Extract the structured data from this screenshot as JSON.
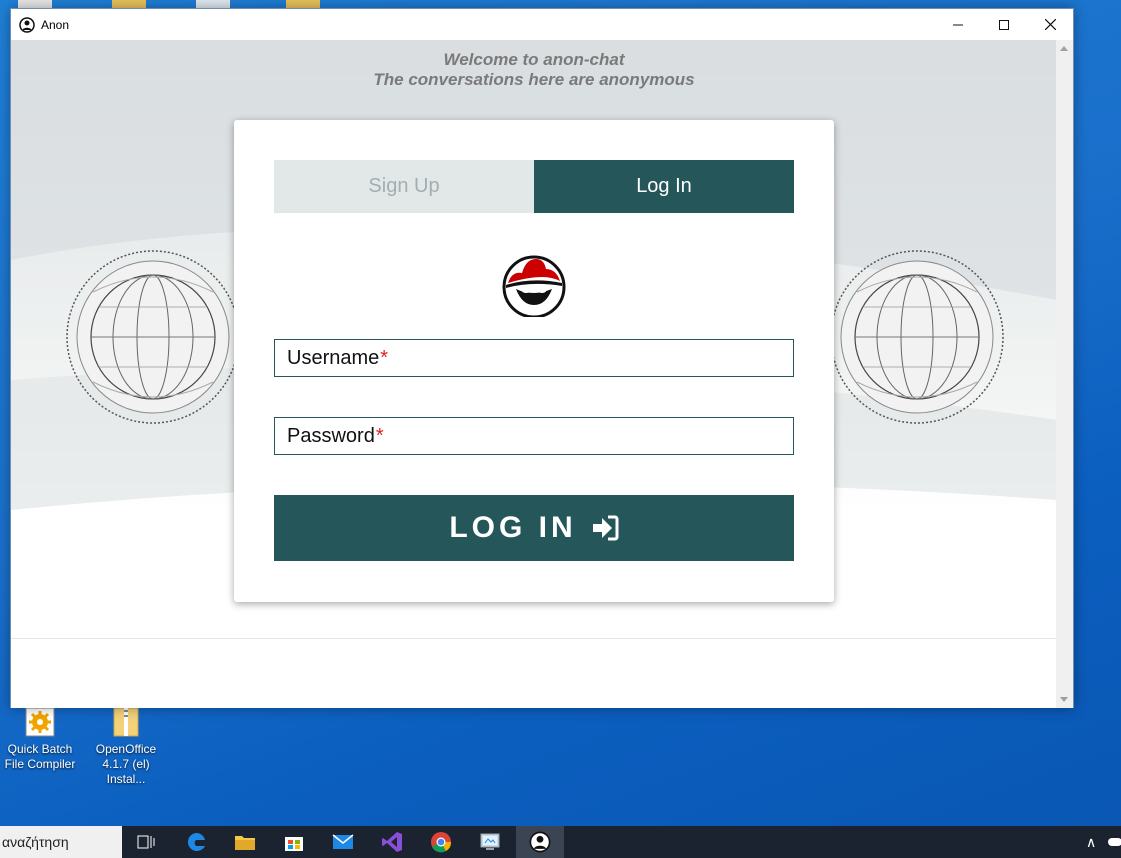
{
  "window": {
    "title": "Anon"
  },
  "welcome": {
    "line1": "Welcome to anon-chat",
    "line2": "The conversations here are anonymous"
  },
  "tabs": [
    {
      "label": "Sign Up",
      "active": false
    },
    {
      "label": "Log In",
      "active": true
    }
  ],
  "form": {
    "username_label": "Username",
    "password_label": "Password",
    "required_mark": "*",
    "submit_label": "LOG IN"
  },
  "desktop_icons": [
    {
      "label": "Quick Batch File Compiler"
    },
    {
      "label": "OpenOffice 4.1.7 (el) Instal..."
    }
  ],
  "taskbar": {
    "search_text": "αναζήτηση",
    "apps": [
      "task-view",
      "edge",
      "file-explorer",
      "store",
      "mail",
      "visual-studio",
      "chrome",
      "control-panel",
      "anon"
    ]
  },
  "colors": {
    "accent": "#24565a",
    "tab_inactive_bg": "#e2e8e7",
    "tab_inactive_text": "#a3aeb0",
    "required": "#e02020"
  }
}
